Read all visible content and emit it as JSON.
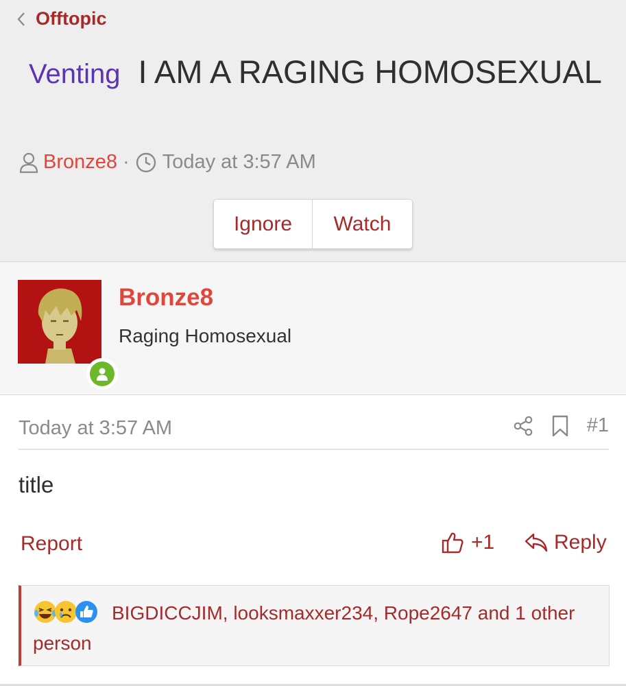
{
  "nav": {
    "back_label": "Offtopic"
  },
  "thread": {
    "prefix": "Venting",
    "title": "I AM A RAGING HOMOSEXUAL",
    "author": "Bronze8",
    "separator": "·",
    "time": "Today at 3:57 AM"
  },
  "buttons": {
    "ignore": "Ignore",
    "watch": "Watch"
  },
  "user": {
    "name": "Bronze8",
    "title": "Raging Homosexual",
    "online": true
  },
  "post": {
    "date": "Today at 3:57 AM",
    "number": "#1",
    "body": "title",
    "report": "Report",
    "like_count": "+1",
    "reply": "Reply"
  },
  "reactions": {
    "text": "BIGDICCJIM, looksmaxxer234, Rope2647 and 1 other person",
    "icons": [
      "laughing-crying-icon",
      "sad-icon",
      "thumbs-up-icon"
    ]
  },
  "colors": {
    "accent": "#a72a2a",
    "username": "#e0463a",
    "prefix": "#5b34b3",
    "online": "#6cb82a",
    "muted": "#8a8a8a"
  }
}
